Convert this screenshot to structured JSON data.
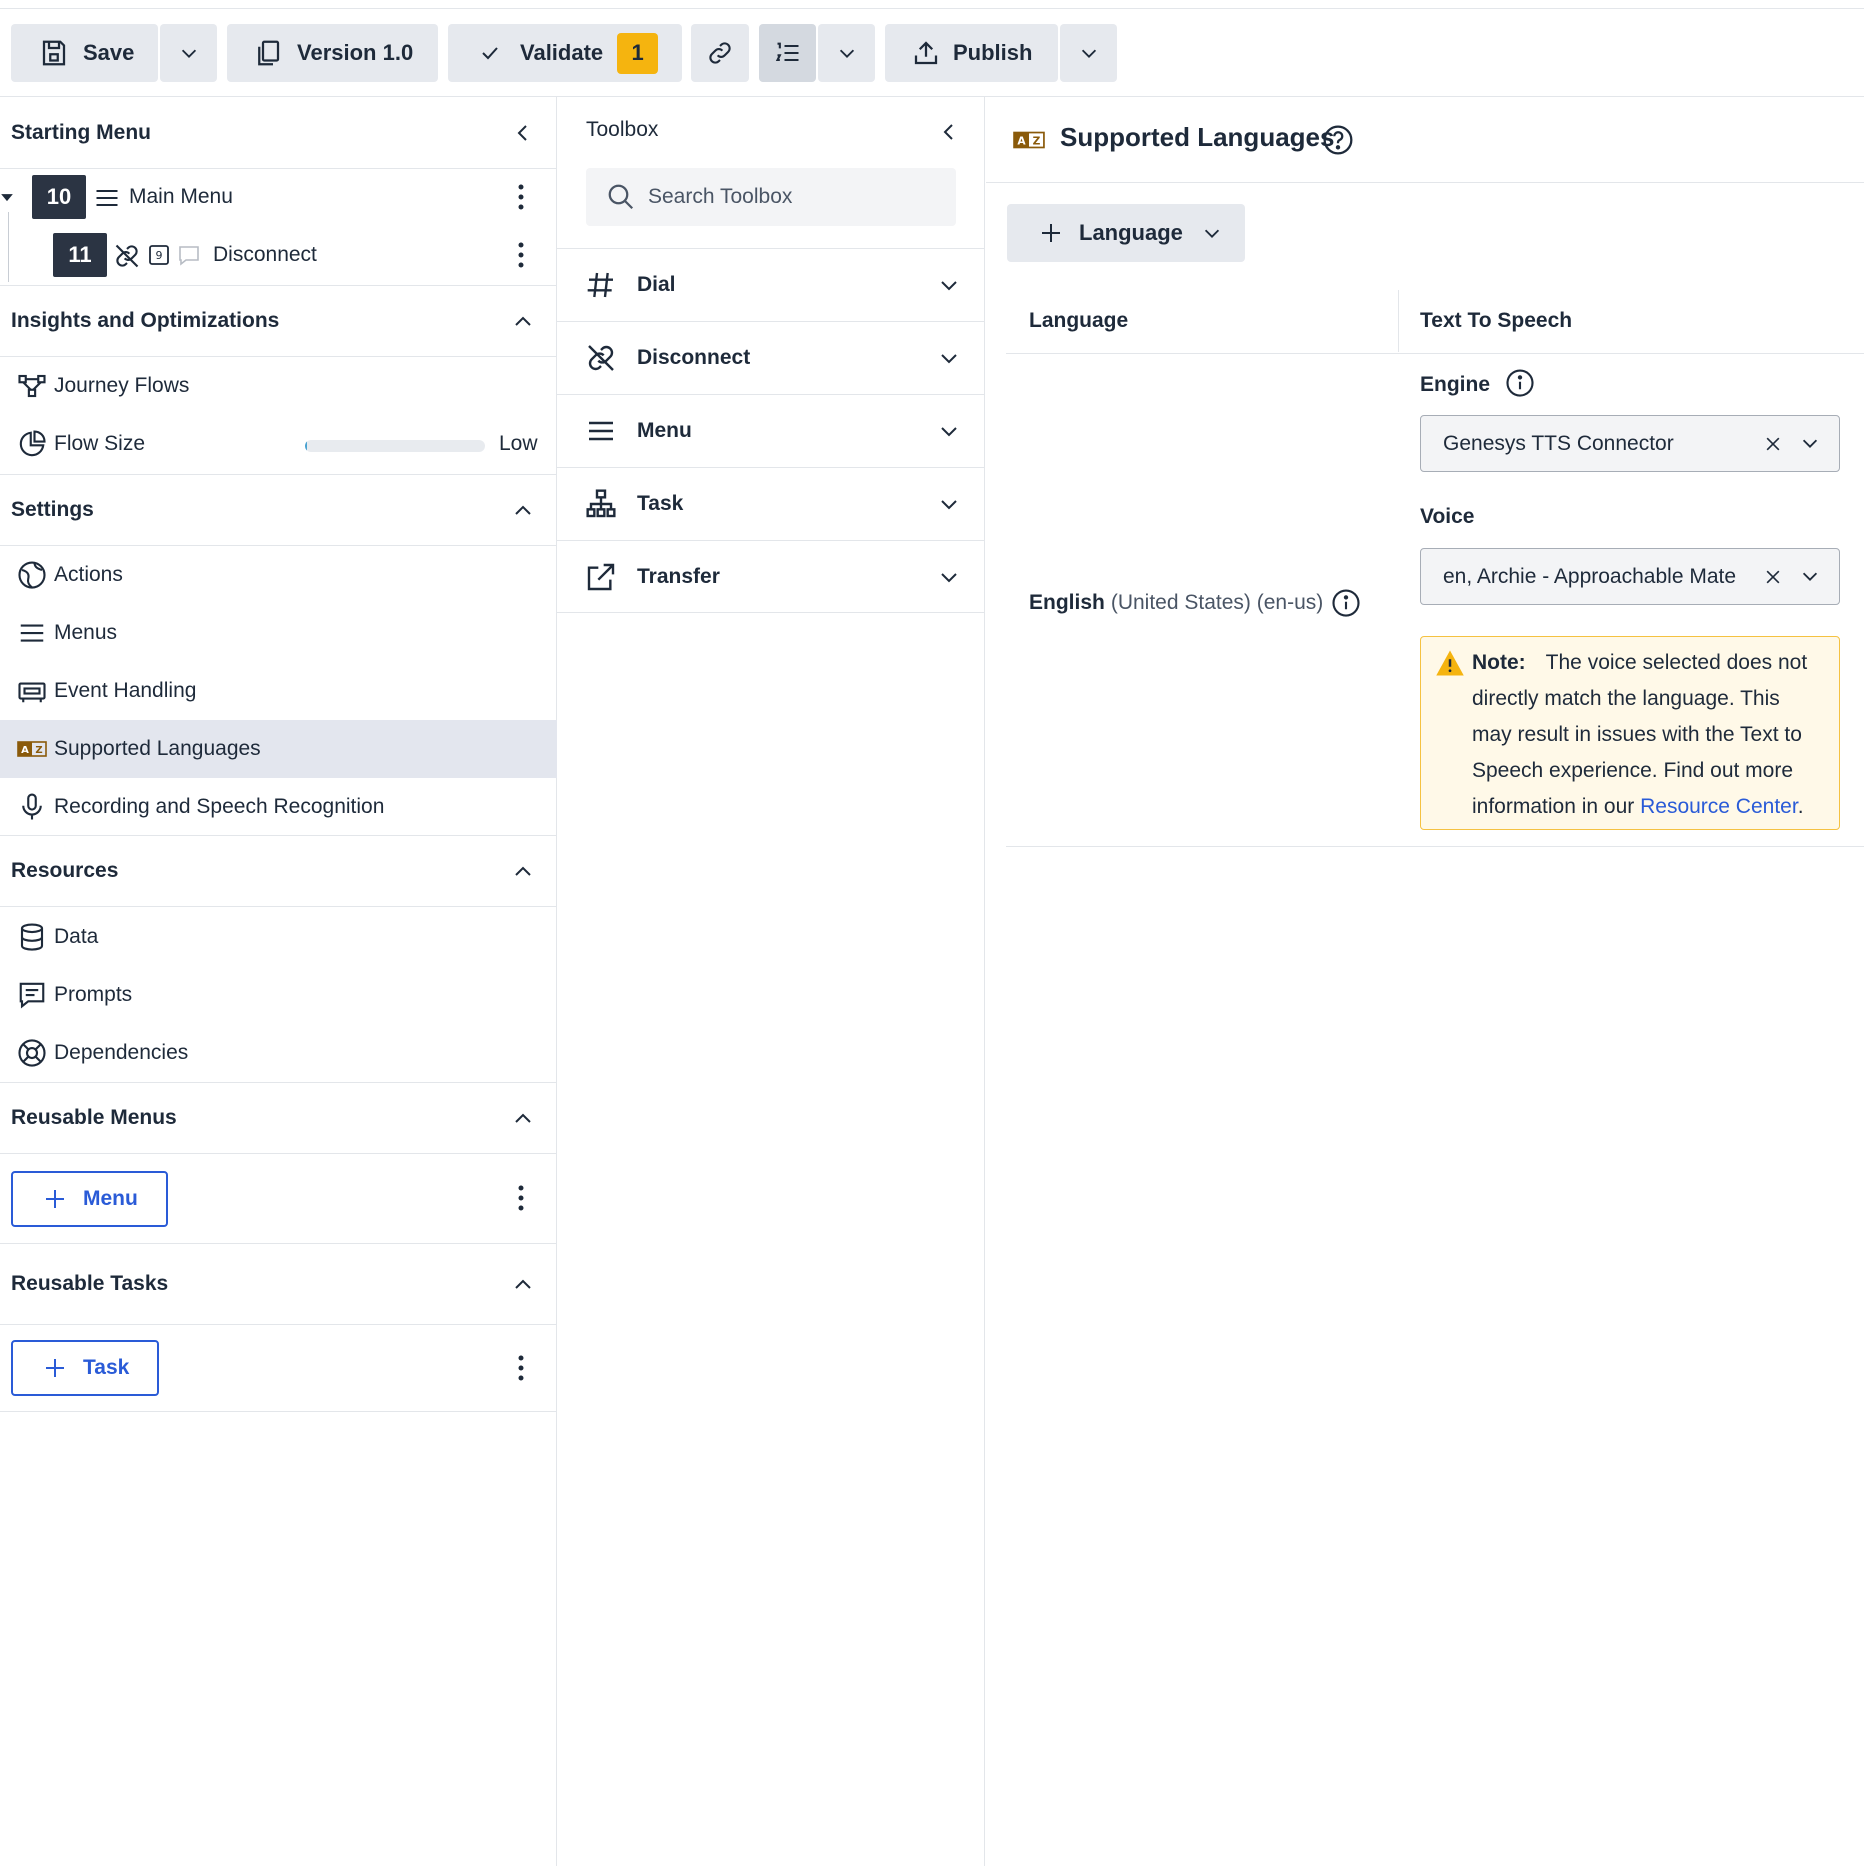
{
  "toolbar": {
    "save_label": "Save",
    "version_label": "Version 1.0",
    "validate_label": "Validate",
    "validate_count": "1",
    "publish_label": "Publish"
  },
  "starting_menu": {
    "title": "Starting Menu",
    "main_menu": {
      "number": "10",
      "label": "Main Menu"
    },
    "disconnect": {
      "number": "11",
      "label": "Disconnect"
    }
  },
  "insights": {
    "title": "Insights and Optimizations",
    "journey_flows": "Journey Flows",
    "flow_size": "Flow Size",
    "flow_size_level": "Low",
    "flow_size_fraction": 0.01
  },
  "settings": {
    "title": "Settings",
    "items": [
      "Actions",
      "Menus",
      "Event Handling",
      "Supported Languages",
      "Recording and Speech Recognition"
    ]
  },
  "resources": {
    "title": "Resources",
    "items": [
      "Data",
      "Prompts",
      "Dependencies"
    ]
  },
  "reusable_menus": {
    "title": "Reusable Menus",
    "add_label": "Menu"
  },
  "reusable_tasks": {
    "title": "Reusable Tasks",
    "add_label": "Task"
  },
  "toolbox": {
    "title": "Toolbox",
    "search_placeholder": "Search Toolbox",
    "categories": [
      "Dial",
      "Disconnect",
      "Menu",
      "Task",
      "Transfer"
    ]
  },
  "supported_languages": {
    "title": "Supported Languages",
    "add_language_label": "Language",
    "columns": [
      "Language",
      "Text To Speech"
    ],
    "row": {
      "language_name": "English",
      "language_detail": "(United States) (en-us)",
      "engine_label": "Engine",
      "engine_value": "Genesys TTS Connector",
      "voice_label": "Voice",
      "voice_value": "en, Archie - Approachable Mate",
      "note_label": "Note:",
      "note_text": "The voice selected does not directly match the language. This may result in issues with the Text to Speech experience. Find out more information in our",
      "note_link": "Resource Center",
      "note_end": "."
    }
  },
  "colors": {
    "accent": "#2a5bd7",
    "badge": "#f5b40f",
    "warning_bg": "#fff9e8",
    "dark_box": "#2b3443"
  }
}
